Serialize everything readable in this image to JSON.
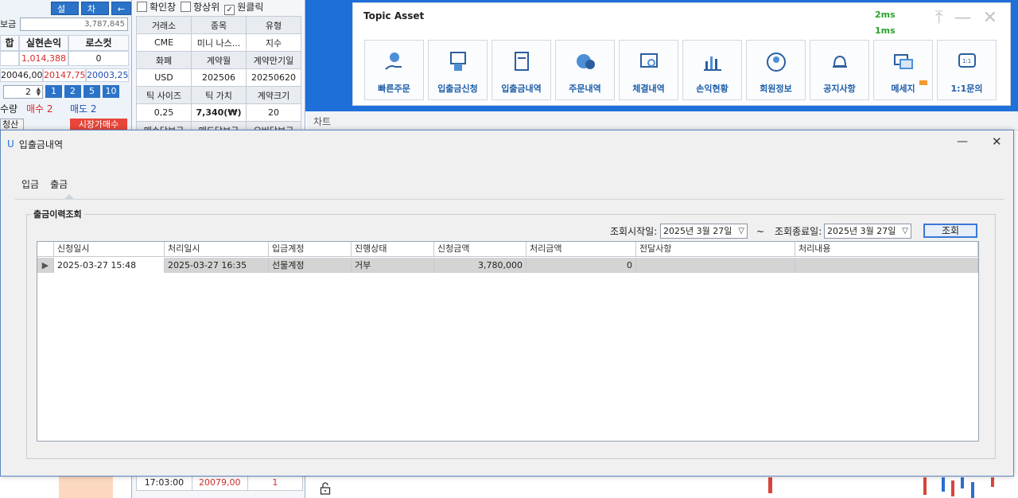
{
  "left_panel": {
    "buttons": [
      "설정",
      "차트",
      "←"
    ],
    "deposit_label": "보금",
    "deposit_value": "3,787,845",
    "headers": [
      "합",
      "실현손익",
      "로스컷"
    ],
    "values": [
      "",
      "1,014,388",
      "0"
    ],
    "prices": [
      "20046,00",
      "20147,75",
      "20003,25"
    ],
    "qty": "2",
    "qty_buttons": [
      "1",
      "2",
      "5",
      "10"
    ],
    "qty_label": "수량",
    "buy_label": "매수 2",
    "sell_label": "매도 2",
    "clear_label": "청산",
    "market_buy_label": "시장가매수"
  },
  "info_panel": {
    "checks": [
      {
        "label": "확인창",
        "checked": false
      },
      {
        "label": "항상위",
        "checked": false
      },
      {
        "label": "원클릭",
        "checked": true
      }
    ],
    "rows": [
      {
        "type": "hdr",
        "cells": [
          "거래소",
          "종목",
          "유형"
        ]
      },
      {
        "type": "val",
        "cells": [
          "CME",
          "미니 나스...",
          "지수"
        ]
      },
      {
        "type": "hdr",
        "cells": [
          "화폐",
          "계약월",
          "계약만기일"
        ]
      },
      {
        "type": "val",
        "cells": [
          "USD",
          "202506",
          "20250620"
        ]
      },
      {
        "type": "hdr",
        "cells": [
          "틱 사이즈",
          "틱 가치",
          "계약크기"
        ]
      },
      {
        "type": "val",
        "cells": [
          "0,25",
          "7,340(₩)",
          "20"
        ]
      },
      {
        "type": "hdr",
        "cells": [
          "매수담보금",
          "매도담보금",
          "오버담보금"
        ]
      }
    ],
    "lower_rows": [
      [
        "17:03:00",
        "20079,00",
        "1"
      ]
    ]
  },
  "topic": {
    "title": "Topic Asset",
    "ms1": "2ms",
    "ms2": "1ms",
    "tiles": [
      {
        "label": "빠른주문",
        "icon": "quick-order-icon"
      },
      {
        "label": "입출금신청",
        "icon": "deposit-request-icon"
      },
      {
        "label": "입출금내역",
        "icon": "deposit-history-icon"
      },
      {
        "label": "주문내역",
        "icon": "order-history-icon"
      },
      {
        "label": "체결내역",
        "icon": "execution-history-icon"
      },
      {
        "label": "손익현황",
        "icon": "profit-chart-icon"
      },
      {
        "label": "회원정보",
        "icon": "member-icon"
      },
      {
        "label": "공지사항",
        "icon": "bell-icon"
      },
      {
        "label": "메세지",
        "icon": "message-icon"
      },
      {
        "label": "1:1문의",
        "icon": "inquiry-icon"
      }
    ]
  },
  "chart_tab": "차트",
  "modal": {
    "title": "입출금내역",
    "tabs": [
      "입금",
      "출금"
    ],
    "group_label": "출금이력조회",
    "start_label": "조회시작일:",
    "start_date": "2025년   3월 27일",
    "tilde": "~",
    "end_label": "조회종료일:",
    "end_date": "2025년   3월 27일",
    "search_label": "조회",
    "columns": [
      "",
      "신청일시",
      "처리일시",
      "입금계정",
      "진행상태",
      "신청금액",
      "처리금액",
      "전달사항",
      "처리내용"
    ],
    "rows": [
      [
        "",
        "2025-03-27 15:48",
        "2025-03-27 16:35",
        "선물계정",
        "거부",
        "3,780,000",
        "0",
        "",
        ""
      ]
    ]
  },
  "colors": {
    "accent_blue": "#2b73c8",
    "sell_red": "#e8463a",
    "latency_green": "#2aa12a"
  }
}
